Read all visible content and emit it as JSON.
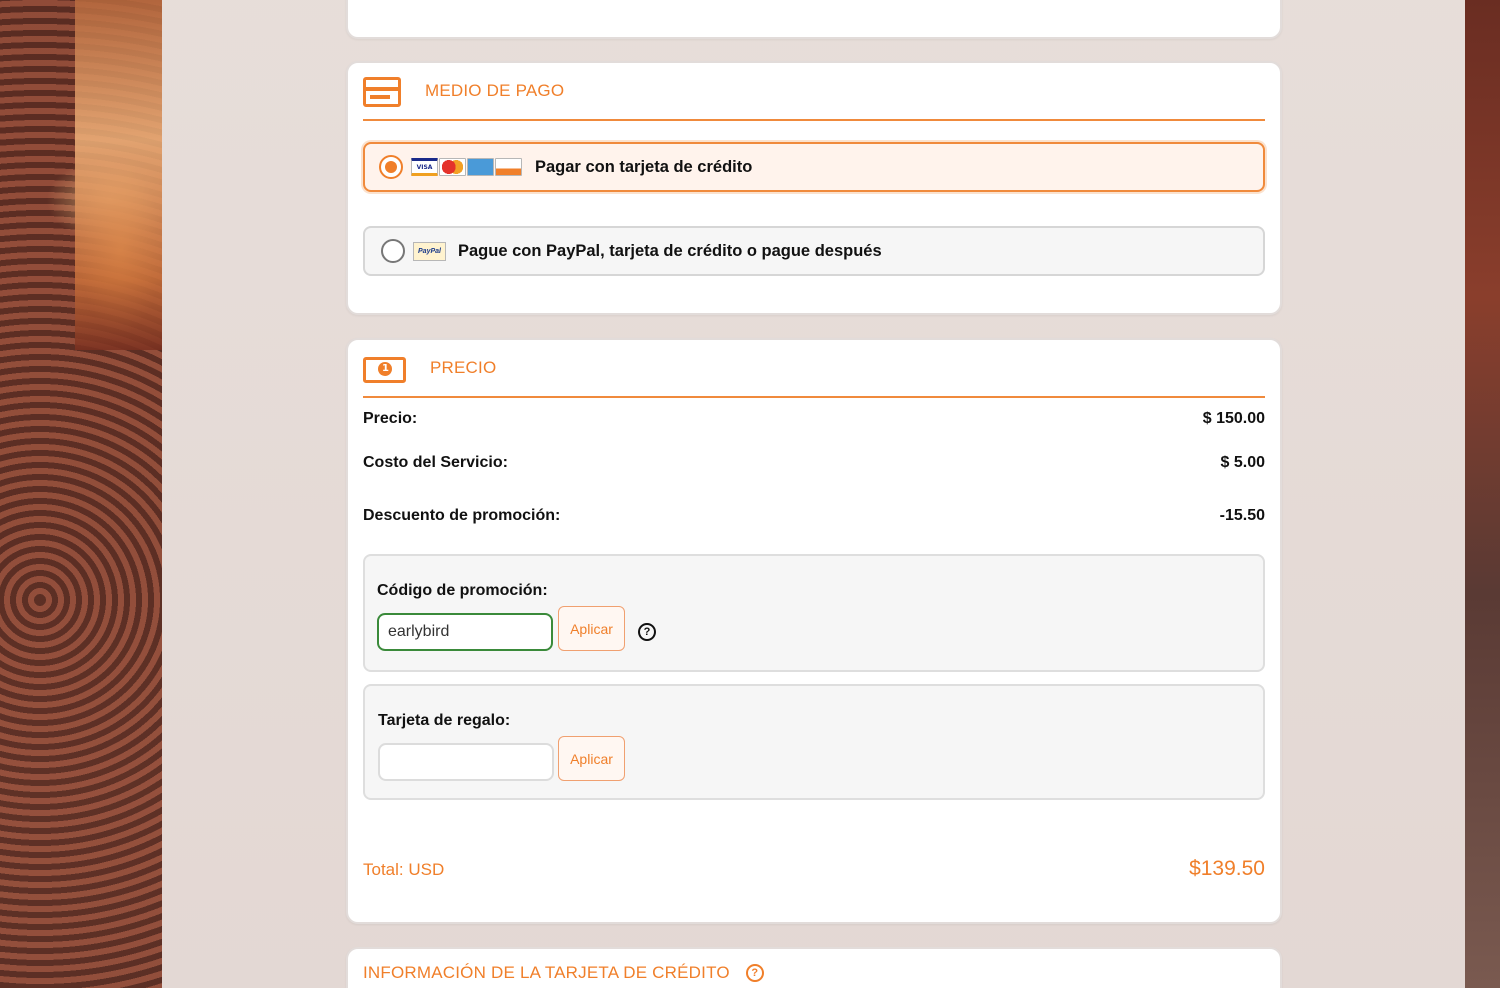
{
  "payment_section": {
    "title": "MEDIO DE PAGO",
    "options": [
      {
        "label": "Pagar con tarjeta de crédito",
        "selected": true,
        "brands": [
          "VISA",
          "MasterCard",
          "AMEX",
          "DISCOVER"
        ]
      },
      {
        "label": "Pague con PayPal, tarjeta de crédito o pague después",
        "selected": false,
        "brands": [
          "PayPal"
        ]
      }
    ]
  },
  "price_section": {
    "title": "PRECIO",
    "rows": [
      {
        "label": "Precio:",
        "value": "$ 150.00"
      },
      {
        "label": "Costo del Servicio:",
        "value": "$ 5.00"
      },
      {
        "label": "Descuento de promoción:",
        "value": "-15.50"
      }
    ],
    "promo": {
      "label": "Código de promoción:",
      "value": "earlybird",
      "button": "Aplicar"
    },
    "gift": {
      "label": "Tarjeta de regalo:",
      "value": "",
      "button": "Aplicar"
    },
    "total_label": "Total: USD",
    "total_value": "$139.50"
  },
  "card_info_section": {
    "title": "INFORMACIÓN DE LA TARJETA DE CRÉDITO"
  },
  "icons": {
    "payment": "credit-card-icon",
    "price": "money-bill-icon",
    "help": "question-circle-icon"
  },
  "colors": {
    "accent": "#f07f2a",
    "valid_border": "#3a8a3a",
    "selected_bg": "#fff3ec"
  }
}
